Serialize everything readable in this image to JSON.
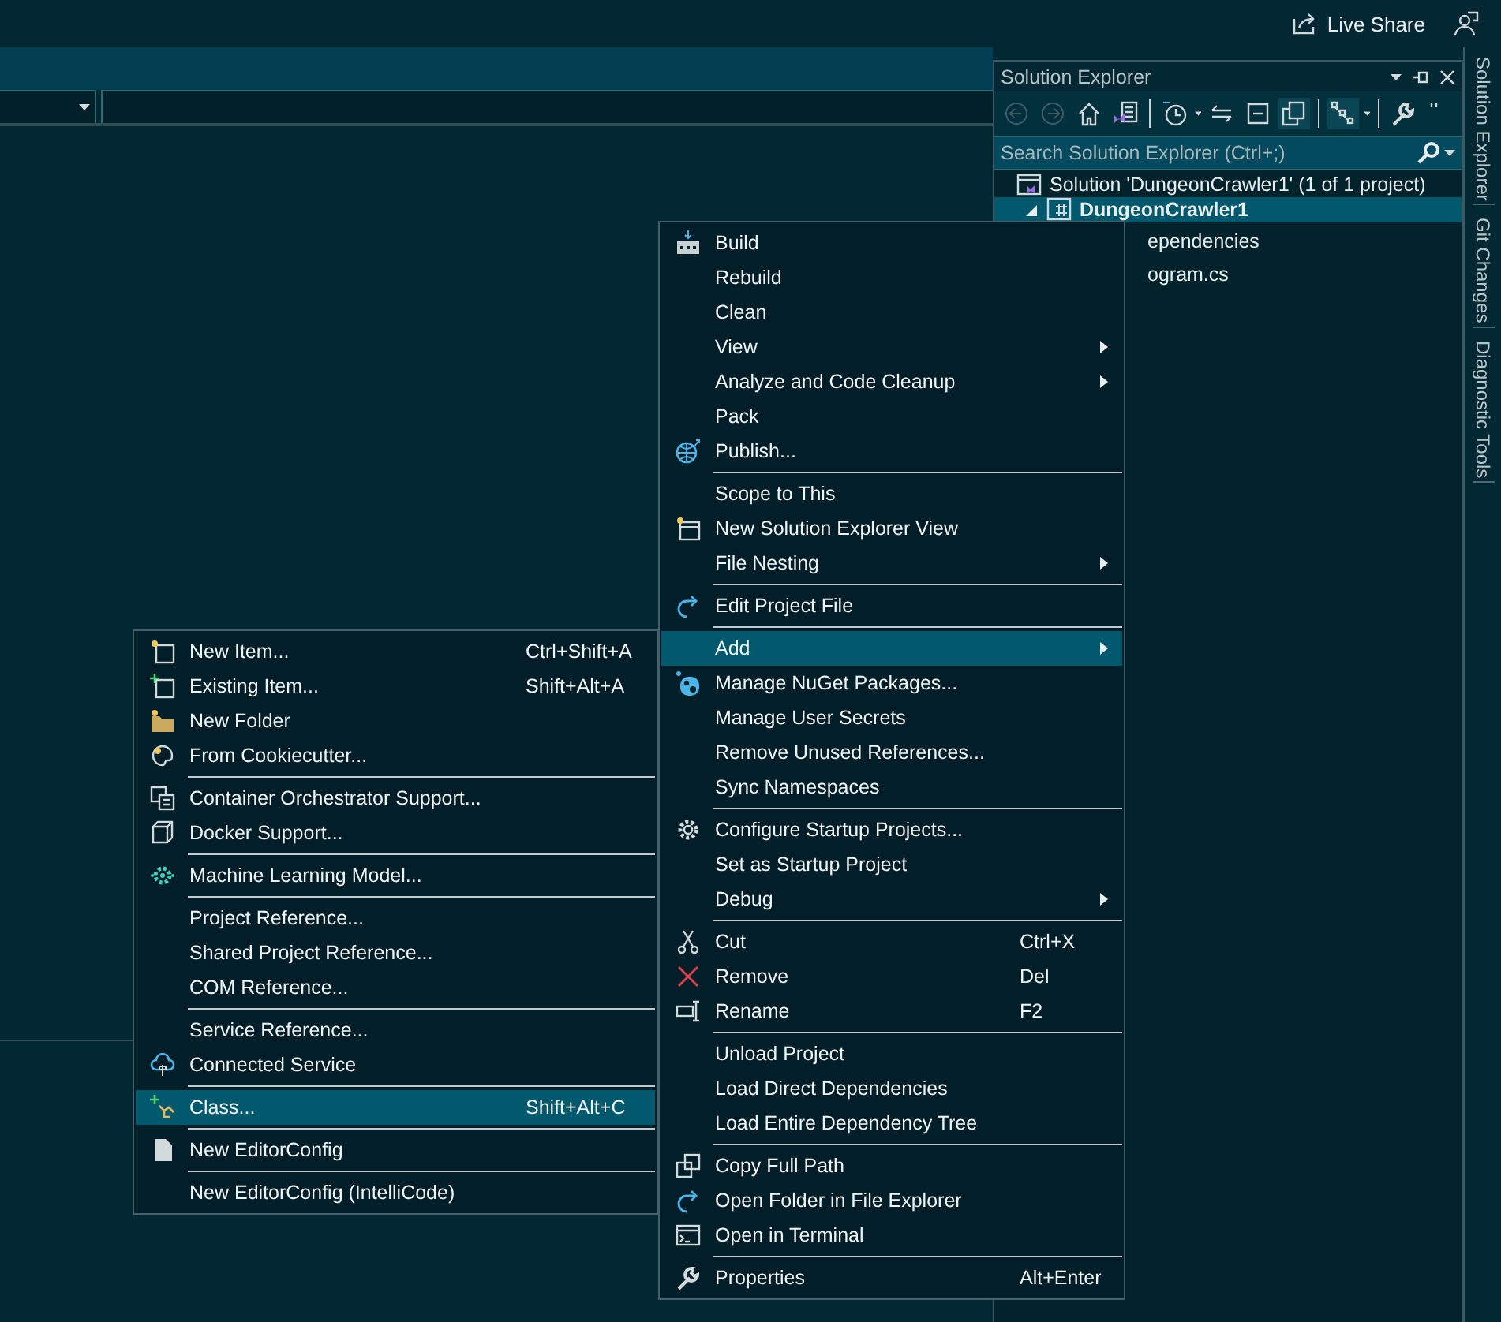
{
  "top_bar": {
    "live_share": "Live Share"
  },
  "solution_explorer": {
    "title": "Solution Explorer",
    "search": {
      "placeholder": "Search Solution Explorer (Ctrl+;)"
    },
    "tree": [
      {
        "label": "Solution 'DungeonCrawler1' (1 of 1 project)",
        "kind": "solution",
        "selected": false,
        "children": [
          {
            "label": "DungeonCrawler1",
            "kind": "project",
            "selected": true,
            "expanded": true,
            "children": [
              {
                "label": "ependencies",
                "kind": "item",
                "selected": false
              },
              {
                "label": "ogram.cs",
                "kind": "item",
                "selected": false
              }
            ]
          }
        ]
      }
    ]
  },
  "side_tabs": [
    "Solution Explorer",
    "Git Changes",
    "Diagnostic Tools"
  ],
  "context_menu": {
    "groups": [
      {
        "items": [
          {
            "label": "Build",
            "selected": false,
            "has_submenu": false
          },
          {
            "label": "Rebuild",
            "selected": false,
            "has_submenu": false
          },
          {
            "label": "Clean",
            "selected": false,
            "has_submenu": false
          },
          {
            "label": "View",
            "selected": false,
            "has_submenu": true
          },
          {
            "label": "Analyze and Code Cleanup",
            "selected": false,
            "has_submenu": true
          },
          {
            "label": "Pack",
            "selected": false,
            "has_submenu": false
          },
          {
            "label": "Publish...",
            "selected": false,
            "has_submenu": false
          }
        ]
      },
      {
        "items": [
          {
            "label": "Scope to This",
            "selected": false,
            "has_submenu": false
          },
          {
            "label": "New Solution Explorer View",
            "selected": false,
            "has_submenu": false
          },
          {
            "label": "File Nesting",
            "selected": false,
            "has_submenu": true
          }
        ]
      },
      {
        "items": [
          {
            "label": "Edit Project File",
            "selected": false,
            "has_submenu": false
          }
        ]
      },
      {
        "items": [
          {
            "label": "Add",
            "selected": true,
            "has_submenu": true
          },
          {
            "label": "Manage NuGet Packages...",
            "selected": false,
            "has_submenu": false
          },
          {
            "label": "Manage User Secrets",
            "selected": false,
            "has_submenu": false
          },
          {
            "label": "Remove Unused References...",
            "selected": false,
            "has_submenu": false
          },
          {
            "label": "Sync Namespaces",
            "selected": false,
            "has_submenu": false
          }
        ]
      },
      {
        "items": [
          {
            "label": "Configure Startup Projects...",
            "selected": false,
            "has_submenu": false
          },
          {
            "label": "Set as Startup Project",
            "selected": false,
            "has_submenu": false
          },
          {
            "label": "Debug",
            "selected": false,
            "has_submenu": true
          }
        ]
      },
      {
        "items": [
          {
            "label": "Cut",
            "shortcut": "Ctrl+X",
            "selected": false,
            "has_submenu": false
          },
          {
            "label": "Remove",
            "shortcut": "Del",
            "selected": false,
            "has_submenu": false
          },
          {
            "label": "Rename",
            "shortcut": "F2",
            "selected": false,
            "has_submenu": false
          }
        ]
      },
      {
        "items": [
          {
            "label": "Unload Project",
            "selected": false,
            "has_submenu": false
          },
          {
            "label": "Load Direct Dependencies",
            "selected": false,
            "has_submenu": false
          },
          {
            "label": "Load Entire Dependency Tree",
            "selected": false,
            "has_submenu": false
          }
        ]
      },
      {
        "items": [
          {
            "label": "Copy Full Path",
            "selected": false,
            "has_submenu": false
          },
          {
            "label": "Open Folder in File Explorer",
            "selected": false,
            "has_submenu": false
          },
          {
            "label": "Open in Terminal",
            "selected": false,
            "has_submenu": false
          }
        ]
      },
      {
        "items": [
          {
            "label": "Properties",
            "shortcut": "Alt+Enter",
            "selected": false,
            "has_submenu": false
          }
        ]
      }
    ]
  },
  "add_submenu": {
    "groups": [
      {
        "items": [
          {
            "label": "New Item...",
            "shortcut": "Ctrl+Shift+A",
            "selected": false
          },
          {
            "label": "Existing Item...",
            "shortcut": "Shift+Alt+A",
            "selected": false
          },
          {
            "label": "New Folder",
            "selected": false
          },
          {
            "label": "From Cookiecutter...",
            "selected": false
          }
        ]
      },
      {
        "items": [
          {
            "label": "Container Orchestrator Support...",
            "selected": false
          },
          {
            "label": "Docker Support...",
            "selected": false
          }
        ]
      },
      {
        "items": [
          {
            "label": "Machine Learning Model...",
            "selected": false
          }
        ]
      },
      {
        "items": [
          {
            "label": "Project Reference...",
            "selected": false
          },
          {
            "label": "Shared Project Reference...",
            "selected": false
          },
          {
            "label": "COM Reference...",
            "selected": false
          }
        ]
      },
      {
        "items": [
          {
            "label": "Service Reference...",
            "selected": false
          },
          {
            "label": "Connected Service",
            "selected": false
          }
        ]
      },
      {
        "items": [
          {
            "label": "Class...",
            "shortcut": "Shift+Alt+C",
            "selected": true
          }
        ]
      },
      {
        "items": [
          {
            "label": "New EditorConfig",
            "selected": false
          }
        ]
      },
      {
        "items": [
          {
            "label": "New EditorConfig (IntelliCode)",
            "selected": false
          }
        ]
      }
    ]
  }
}
